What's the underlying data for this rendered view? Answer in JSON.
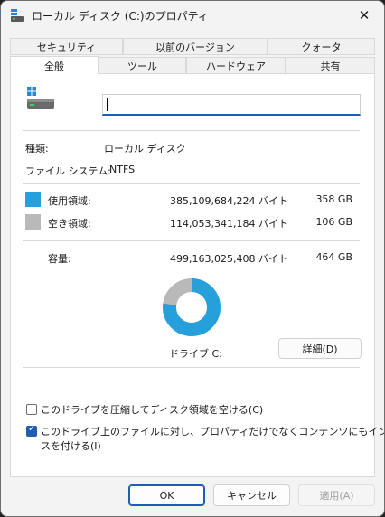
{
  "window": {
    "title": "ローカル ディスク (C:)のプロパティ"
  },
  "tabs": {
    "row_top": [
      "セキュリティ",
      "以前のバージョン",
      "クォータ"
    ],
    "row_bottom": [
      "全般",
      "ツール",
      "ハードウェア",
      "共有"
    ]
  },
  "general": {
    "name_value": "",
    "type_label": "種類:",
    "type_value": "ローカル ディスク",
    "fs_label": "ファイル システム:",
    "fs_value": "NTFS",
    "used_label": "使用領域:",
    "used_bytes": "385,109,684,224 バイト",
    "used_size": "358 GB",
    "free_label": "空き領域:",
    "free_bytes": "114,053,341,184 バイト",
    "free_size": "106 GB",
    "capacity_label": "容量:",
    "capacity_bytes": "499,163,025,408 バイト",
    "capacity_size": "464 GB",
    "drive_label": "ドライブ C:",
    "details_button": "詳細(D)",
    "compress_label": "このドライブを圧縮してディスク領域を空ける(C)",
    "compress_checked": false,
    "index_label_line1": "このドライブ上のファイルに対し、プロパティだけでなくコンテンツにもインデック",
    "index_label_line2": "スを付ける(I)",
    "index_checked": true
  },
  "buttons": {
    "ok": "OK",
    "cancel": "キャンセル",
    "apply": "適用(A)"
  },
  "colors": {
    "used": "#26a0da",
    "free": "#b9b9b9",
    "accent": "#1b5eb8"
  },
  "chart_data": {
    "type": "pie",
    "categories": [
      "使用領域",
      "空き領域"
    ],
    "values": [
      385109684224,
      114053341184
    ]
  }
}
